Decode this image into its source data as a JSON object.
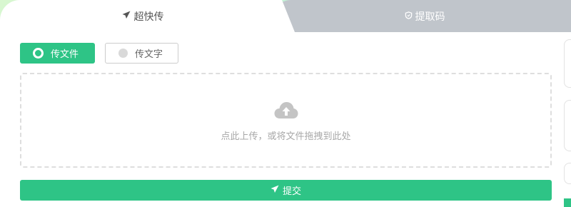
{
  "tabs": {
    "quick_upload": "超快传",
    "pickup_code": "提取码"
  },
  "modes": {
    "file": "传文件",
    "text": "传文字",
    "selected": "file"
  },
  "dropzone": {
    "hint": "点此上传，或将文件拖拽到此处"
  },
  "submit": {
    "label": "提交"
  },
  "icons": {
    "send": "paper-plane-icon",
    "code": "shield-icon",
    "upload": "cloud-upload-icon"
  },
  "colors": {
    "accent": "#2ec486",
    "inactive_tab": "#c0c5cb"
  }
}
